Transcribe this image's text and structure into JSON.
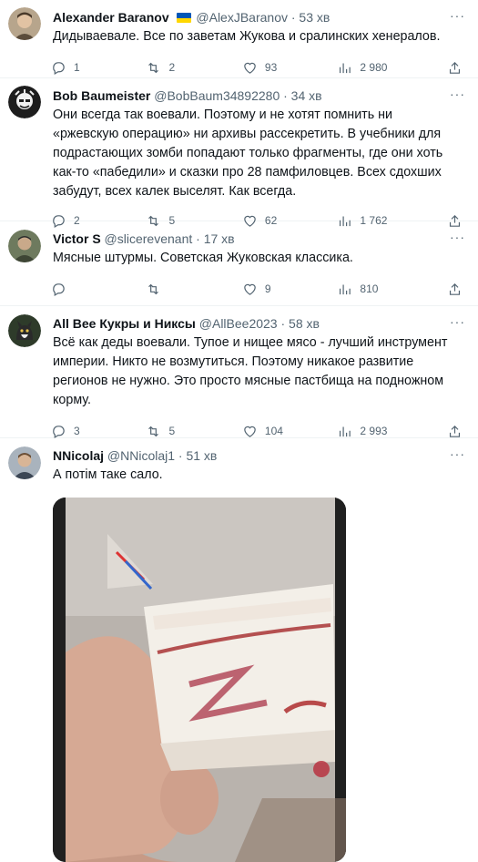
{
  "tweets": [
    {
      "name": "Alexander Baranov",
      "handle": "@AlexJBaranov",
      "time": "· 53 хв",
      "text": "Дидываевале. Все по заветам Жукова и сралинских хенералов.",
      "replies": "1",
      "retweets": "2",
      "likes": "93",
      "views": "2 980"
    },
    {
      "name": "Bob Baumeister",
      "handle": "@BobBaum34892280",
      "time": "· 34 хв",
      "text": "Они всегда так воевали. Поэтому и не хотят помнить ни «ржевскую операцию» ни архивы рассекретить. В учебники для подрастающих зомби попадают только фрагменты, где они хоть как-то «пабедили» и сказки про 28 памфиловцев. Всех сдохших забудут, всех калек выселят. Как всегда.",
      "replies": "2",
      "retweets": "5",
      "likes": "62",
      "views": "1 762"
    },
    {
      "name": "Victor S",
      "handle": "@slicerevenant",
      "time": "· 17 хв",
      "text": "Мясные штурмы. Советская Жуковская классика.",
      "replies": "",
      "retweets": "",
      "likes": "9",
      "views": "810"
    },
    {
      "name": "All Bee Кукры и Никсы",
      "handle": "@AllBee2023",
      "time": "· 58 хв",
      "text": "Всё как деды воевали. Тупое и нищее мясо - лучший инструмент империи. Никто не возмутиться. Поэтому никакое развитие регионов не нужно. Это просто мясные пастбища на подножном корму.",
      "replies": "3",
      "retweets": "5",
      "likes": "104",
      "views": "2 993"
    },
    {
      "name": "NNicolaj",
      "handle": "@NNicolaj1",
      "time": "· 51 хв",
      "text": "А потім таке сало."
    }
  ],
  "colors": {
    "flag_blue": "#0057b7",
    "flag_yellow": "#ffd700",
    "secondary_text": "#536471"
  },
  "icons": [
    "reply-icon",
    "retweet-icon",
    "like-icon",
    "views-icon",
    "share-icon",
    "more-icon"
  ]
}
